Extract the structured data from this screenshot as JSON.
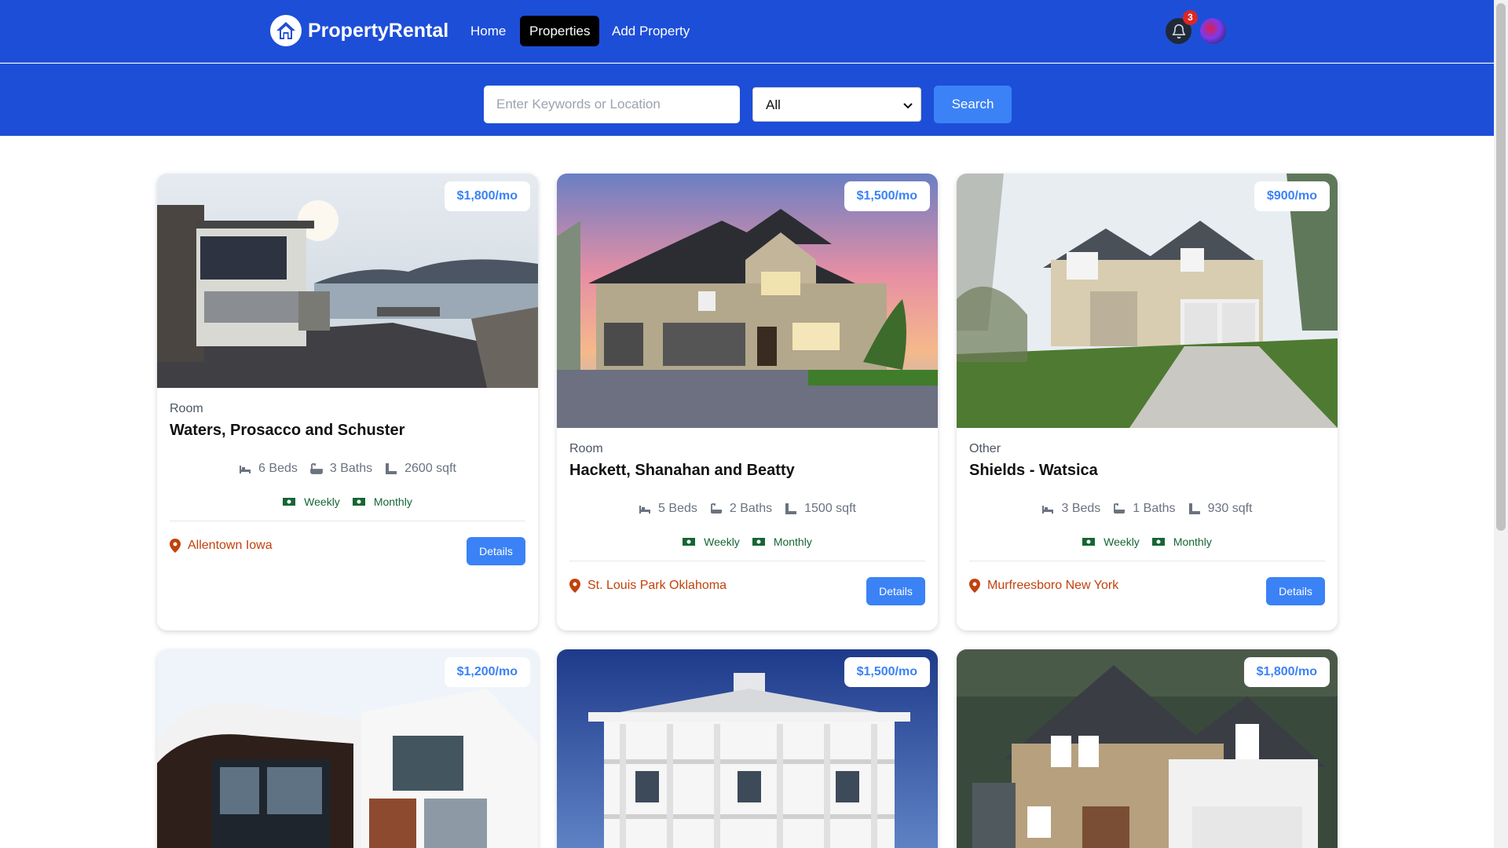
{
  "brand": {
    "name": "PropertyRental"
  },
  "nav": {
    "home": "Home",
    "properties": "Properties",
    "add_property": "Add Property"
  },
  "notifications": {
    "count": "3"
  },
  "search": {
    "placeholder": "Enter Keywords or Location",
    "type_selected": "All",
    "button": "Search"
  },
  "colors": {
    "primary": "#1d4ed8",
    "accent": "#3b82f6",
    "active_nav": "#000000",
    "location": "#c2410c",
    "rates": "#166534",
    "badge": "#dc2626"
  },
  "listings": [
    {
      "price": "$1,800/mo",
      "type": "Room",
      "name": "Waters, Prosacco and Schuster",
      "beds": "6 Beds",
      "baths": "3 Baths",
      "sqft": "2600 sqft",
      "rate_weekly": "Weekly",
      "rate_monthly": "Monthly",
      "location": "Allentown Iowa",
      "details": "Details"
    },
    {
      "price": "$1,500/mo",
      "type": "Room",
      "name": "Hackett, Shanahan and Beatty",
      "beds": "5 Beds",
      "baths": "2 Baths",
      "sqft": "1500 sqft",
      "rate_weekly": "Weekly",
      "rate_monthly": "Monthly",
      "location": "St. Louis Park Oklahoma",
      "details": "Details"
    },
    {
      "price": "$900/mo",
      "type": "Other",
      "name": "Shields - Watsica",
      "beds": "3 Beds",
      "baths": "1 Baths",
      "sqft": "930 sqft",
      "rate_weekly": "Weekly",
      "rate_monthly": "Monthly",
      "location": "Murfreesboro New York",
      "details": "Details"
    },
    {
      "price": "$1,200/mo"
    },
    {
      "price": "$1,500/mo"
    },
    {
      "price": "$1,800/mo"
    }
  ]
}
